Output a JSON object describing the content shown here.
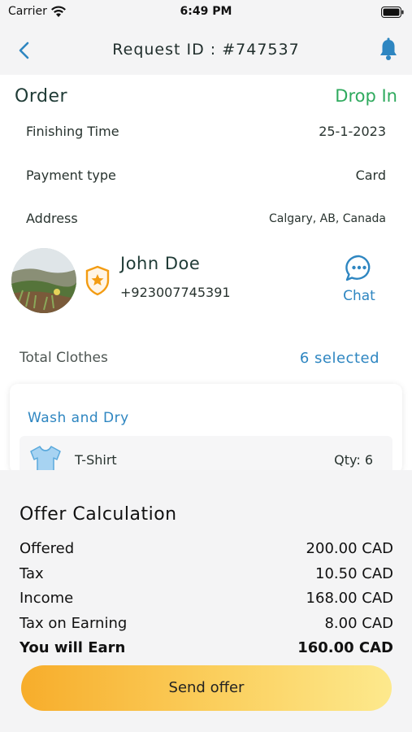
{
  "status_bar": {
    "carrier": "Carrier",
    "time": "6:49 PM"
  },
  "nav": {
    "title": "Request ID : #747537",
    "back_icon": "chevron-left-icon",
    "bell_icon": "bell-icon"
  },
  "order": {
    "title": "Order",
    "status": "Drop In",
    "finishing_time_label": "Finishing Time",
    "finishing_time": "25-1-2023",
    "payment_label": "Payment type",
    "payment": "Card",
    "address_label": "Address",
    "address": "Calgary, AB, Canada"
  },
  "customer": {
    "name": "John Doe",
    "phone": "+923007745391",
    "chat_label": "Chat"
  },
  "clothes": {
    "label": "Total Clothes",
    "value": "6 selected"
  },
  "service": {
    "title": "Wash and Dry",
    "item_name": "T-Shirt",
    "item_qty": "Qty: 6"
  },
  "offer": {
    "title": "Offer Calculation",
    "rows": [
      {
        "label": "Offered",
        "value": "200.00 CAD"
      },
      {
        "label": "Tax",
        "value": "10.50 CAD"
      },
      {
        "label": "Income",
        "value": "168.00 CAD"
      },
      {
        "label": "Tax on Earning",
        "value": "8.00 CAD"
      },
      {
        "label": "You will Earn",
        "value": "160.00 CAD"
      }
    ],
    "send_label": "Send offer"
  },
  "colors": {
    "accent_blue": "#2e86c1",
    "status_green": "#2faa5e",
    "button_start": "#f7ad2b",
    "button_end": "#fde98d"
  }
}
